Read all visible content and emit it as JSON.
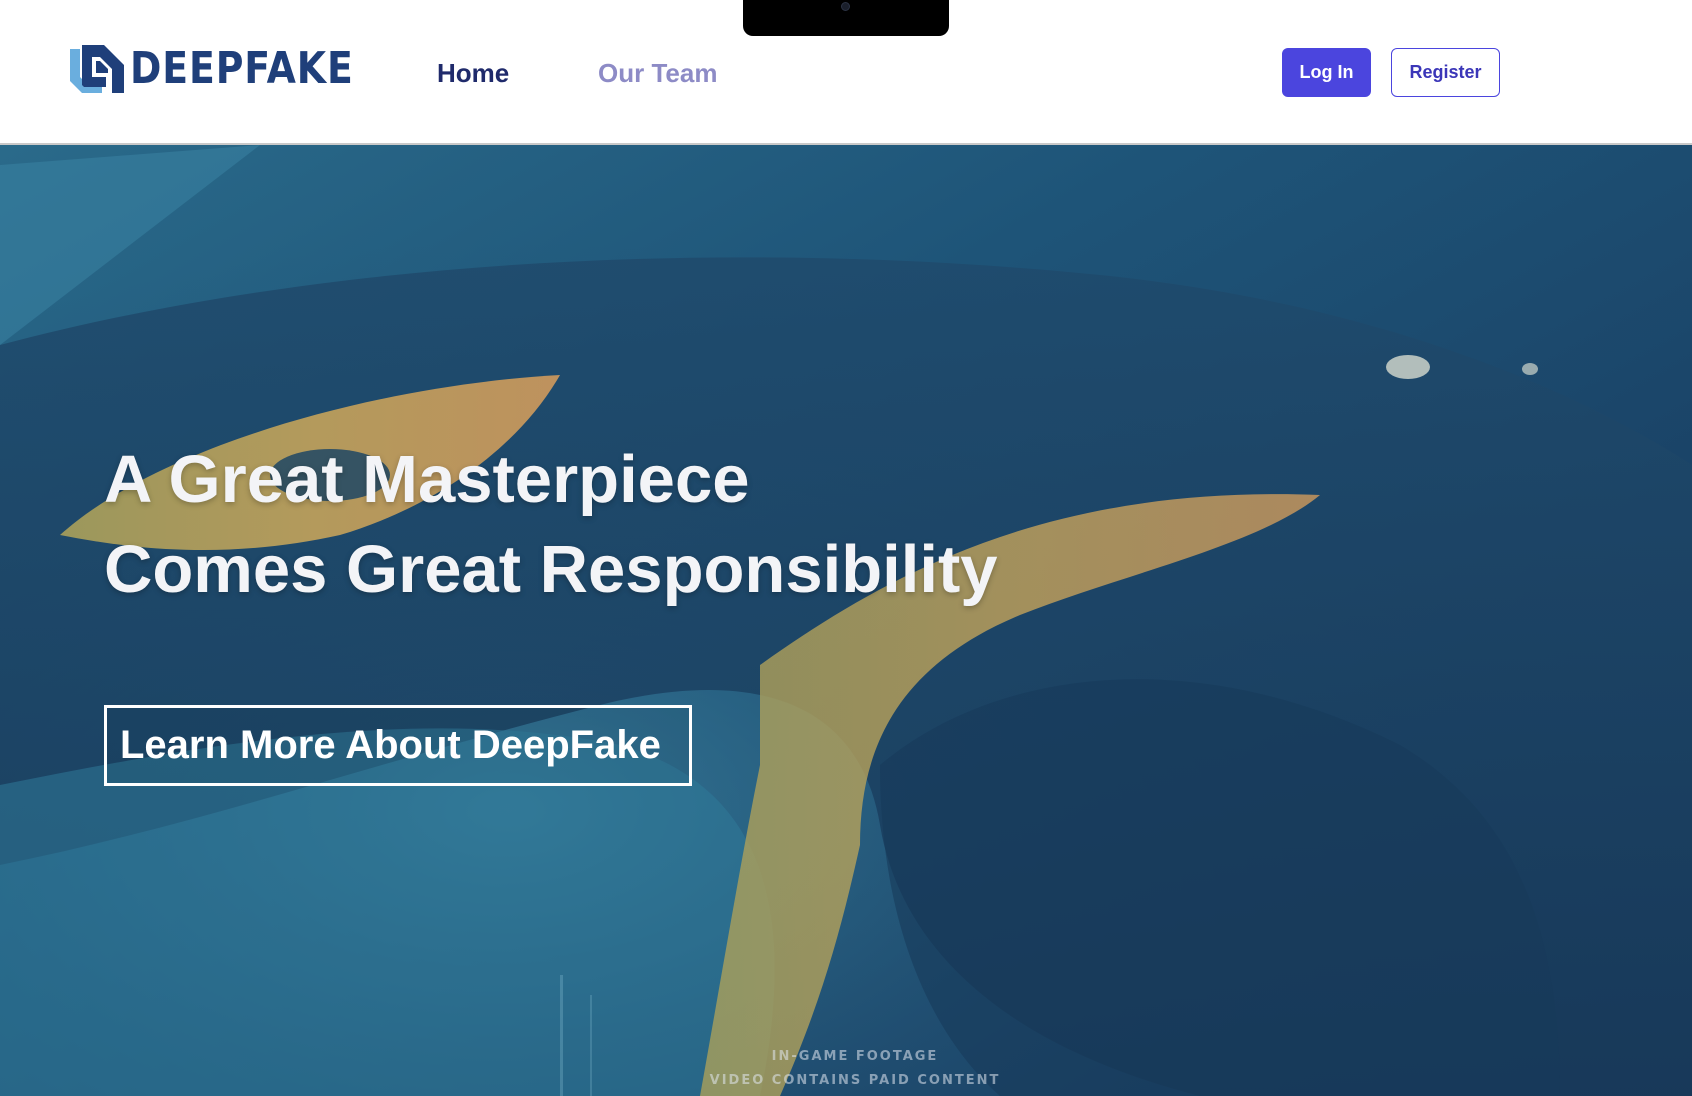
{
  "brand": {
    "name": "DEEPFAKE",
    "colors": {
      "primary": "#1f3f7a",
      "light": "#6aaede"
    }
  },
  "nav": {
    "items": [
      {
        "label": "Home",
        "active": true
      },
      {
        "label": "Our Team",
        "active": false
      }
    ]
  },
  "auth": {
    "login_label": "Log In",
    "register_label": "Register",
    "accent": "#4b45de"
  },
  "hero": {
    "headline_line1": "A Great Masterpiece",
    "headline_line2": "Comes Great Responsibility",
    "cta_label": "Learn More About DeepFake",
    "overlay_line1": "IN-GAME FOOTAGE",
    "overlay_line2": "VIDEO CONTAINS PAID CONTENT"
  },
  "icons": {
    "logo": "deepfake-logo-icon",
    "camera": "camera-icon"
  }
}
